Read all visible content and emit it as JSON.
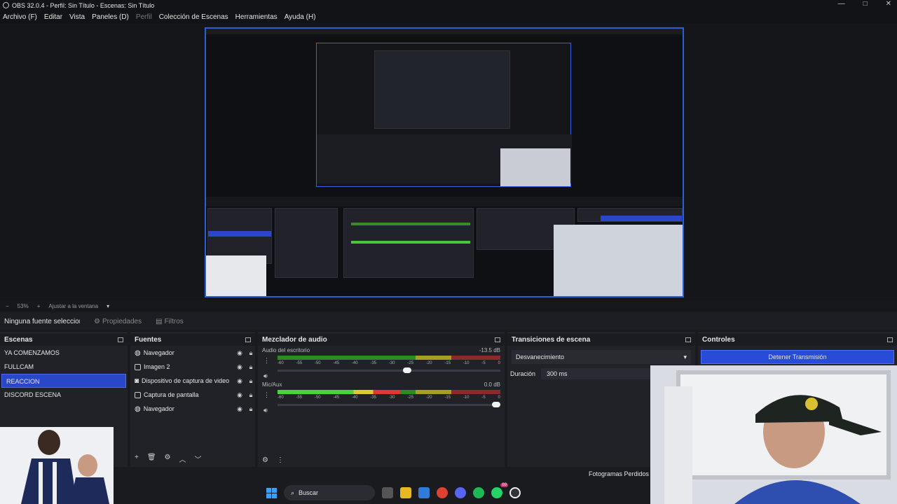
{
  "window": {
    "title": "OBS 32.0.4 - Perfil: Sin Título - Escenas: Sin Título",
    "controls": [
      "—",
      "□",
      "✕"
    ]
  },
  "menu": [
    {
      "label": "Archivo (F)",
      "disabled": false
    },
    {
      "label": "Editar",
      "disabled": false
    },
    {
      "label": "Vista",
      "disabled": false
    },
    {
      "label": "Paneles (D)",
      "disabled": false
    },
    {
      "label": "Perfil",
      "disabled": true
    },
    {
      "label": "Colección de Escenas",
      "disabled": false
    },
    {
      "label": "Herramientas",
      "disabled": false
    },
    {
      "label": "Ayuda (H)",
      "disabled": false
    }
  ],
  "zoom": {
    "minus": "−",
    "value": "53%",
    "plus": "+",
    "fit": "Ajustar a la ventana"
  },
  "source_bar": {
    "none_selected": "Ninguna fuente seleccionada",
    "properties": "Propiedades",
    "filters": "Filtros"
  },
  "scenes": {
    "title": "Escenas",
    "items": [
      "YA COMENZAMOS",
      "FULLCAM",
      "REACCION",
      "DISCORD ESCENA"
    ],
    "selected": 2
  },
  "sources": {
    "title": "Fuentes",
    "items": [
      "Navegador",
      "Imagen 2",
      "Dispositivo de captura de video",
      "Captura de pantalla",
      "Navegador"
    ]
  },
  "mixer": {
    "title": "Mezclador de audio",
    "ticks": [
      "-60",
      "-55",
      "-50",
      "-45",
      "-40",
      "-35",
      "-30",
      "-25",
      "-20",
      "-15",
      "-10",
      "-5",
      "0"
    ],
    "channels": [
      {
        "name": "Audio del escritorio",
        "db": "-13.5 dB",
        "level": 0.0,
        "volume": 0.6
      },
      {
        "name": "Mic/Aux",
        "db": "0.0 dB",
        "level": 0.55,
        "volume": 1.0
      }
    ]
  },
  "transitions": {
    "title": "Transiciones de escena",
    "selected": "Desvanecimiento",
    "duration_label": "Duración",
    "duration_value": "300 ms"
  },
  "controls": {
    "title": "Controles",
    "stop_stream": "Detener Transmisión"
  },
  "status": {
    "dropped_frames": "Fotogramas Perdidos"
  },
  "taskbar": {
    "search": "Buscar",
    "notification_count": "69"
  },
  "colors": {
    "accent": "#2a47c9",
    "preview_border": "#2a5fd8"
  }
}
